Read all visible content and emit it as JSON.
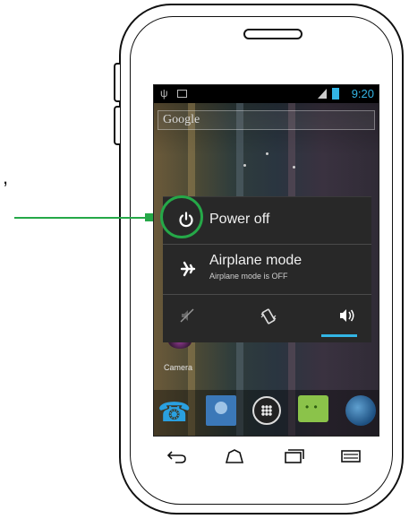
{
  "status_bar": {
    "time": "9:20"
  },
  "search": {
    "label": "Google"
  },
  "power_menu": {
    "power_off": {
      "label": "Power off",
      "icon": "power-icon"
    },
    "airplane": {
      "label": "Airplane mode",
      "sublabel": "Airplane mode is OFF",
      "icon": "airplane-icon"
    },
    "sound_modes": [
      {
        "icon": "silent-icon"
      },
      {
        "icon": "vibrate-icon"
      },
      {
        "icon": "sound-on-icon",
        "selected": true
      }
    ]
  },
  "home": {
    "camera_label": "Camera"
  },
  "dock": [
    "phone-icon",
    "contacts-icon",
    "apps-icon",
    "messaging-icon",
    "browser-icon"
  ],
  "nav_keys": [
    "back-key",
    "home-key",
    "recent-apps-key",
    "menu-key"
  ],
  "annotation": {
    "pointer_color": "#25a848",
    "stray_mark": ","
  },
  "colors": {
    "accent": "#33b5e5",
    "menu_bg": "#282828",
    "highlight": "#25a848"
  }
}
